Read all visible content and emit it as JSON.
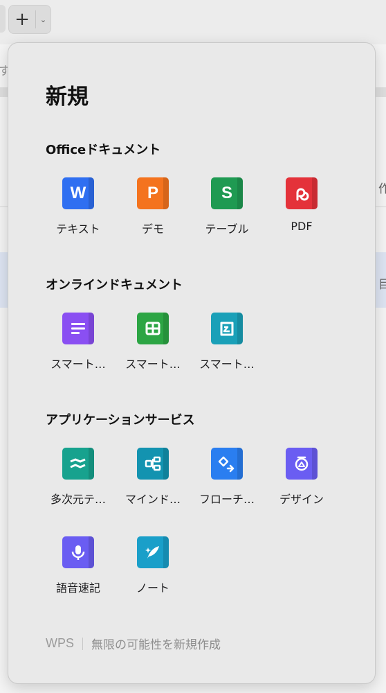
{
  "toolbar": {
    "plus_symbol": "+",
    "chevron": "⌄"
  },
  "background": {
    "ghost_text_1": "す",
    "ghost_text_2": "作",
    "ghost_text_3": "目"
  },
  "popover": {
    "title": "新規",
    "sections": [
      {
        "title": "Officeドキュメント",
        "items": [
          {
            "label": "テキスト",
            "glyph": "W",
            "icon": "word-icon",
            "color": "#2f6ff1"
          },
          {
            "label": "デモ",
            "glyph": "P",
            "icon": "presentation-icon",
            "color": "#f4731e"
          },
          {
            "label": "テーブル",
            "glyph": "S",
            "icon": "spreadsheet-icon",
            "color": "#1f9a52"
          },
          {
            "label": "PDF",
            "glyph": "",
            "icon": "pdf-icon",
            "color": "#e4323a"
          }
        ]
      },
      {
        "title": "オンラインドキュメント",
        "items": [
          {
            "label": "スマート…",
            "icon": "smart-doc-icon",
            "color": "#8a4ff2"
          },
          {
            "label": "スマート…",
            "icon": "smart-sheet-icon",
            "color": "#2ca544"
          },
          {
            "label": "スマート…",
            "icon": "smart-form-icon",
            "color": "#1aa0b8"
          }
        ]
      },
      {
        "title": "アプリケーションサービス",
        "items": [
          {
            "label": "多次元テ…",
            "icon": "multidimensional-table-icon",
            "color": "#17a28e"
          },
          {
            "label": "マインド…",
            "icon": "mind-map-icon",
            "color": "#1393b0"
          },
          {
            "label": "フローチ…",
            "icon": "flowchart-icon",
            "color": "#2a7ef0"
          },
          {
            "label": "デザイン",
            "icon": "design-icon",
            "color": "#6a5df2"
          },
          {
            "label": "語音速記",
            "icon": "voice-memo-icon",
            "color": "#6a5df2"
          },
          {
            "label": "ノート",
            "icon": "note-icon",
            "color": "#1a9fc9"
          }
        ]
      }
    ],
    "footer": {
      "brand": "WPS",
      "tagline": "無限の可能性を新規作成"
    }
  }
}
